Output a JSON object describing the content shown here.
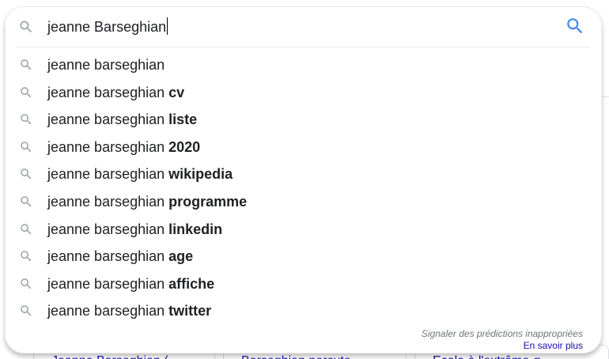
{
  "search": {
    "query": "jeanne Barseghian",
    "lead_icon": "search-icon",
    "button_icon": "search-icon",
    "accent_color": "#4285f4"
  },
  "suggestions": [
    {
      "prefix": "jeanne barseghian",
      "completion": ""
    },
    {
      "prefix": "jeanne barseghian ",
      "completion": "cv"
    },
    {
      "prefix": "jeanne barseghian ",
      "completion": "liste"
    },
    {
      "prefix": "jeanne barseghian ",
      "completion": "2020"
    },
    {
      "prefix": "jeanne barseghian ",
      "completion": "wikipedia"
    },
    {
      "prefix": "jeanne barseghian ",
      "completion": "programme"
    },
    {
      "prefix": "jeanne barseghian ",
      "completion": "linkedin"
    },
    {
      "prefix": "jeanne barseghian ",
      "completion": "age"
    },
    {
      "prefix": "jeanne barseghian ",
      "completion": "affiche"
    },
    {
      "prefix": "jeanne barseghian ",
      "completion": "twitter"
    }
  ],
  "footer": {
    "report_link": "Signaler des prédictions inappropriées",
    "learn_more": "En savoir plus"
  },
  "background_cards": [
    "Jeanne Barseghian (",
    "Barseghian percute",
    "Ecolo à l'extrême-g"
  ]
}
